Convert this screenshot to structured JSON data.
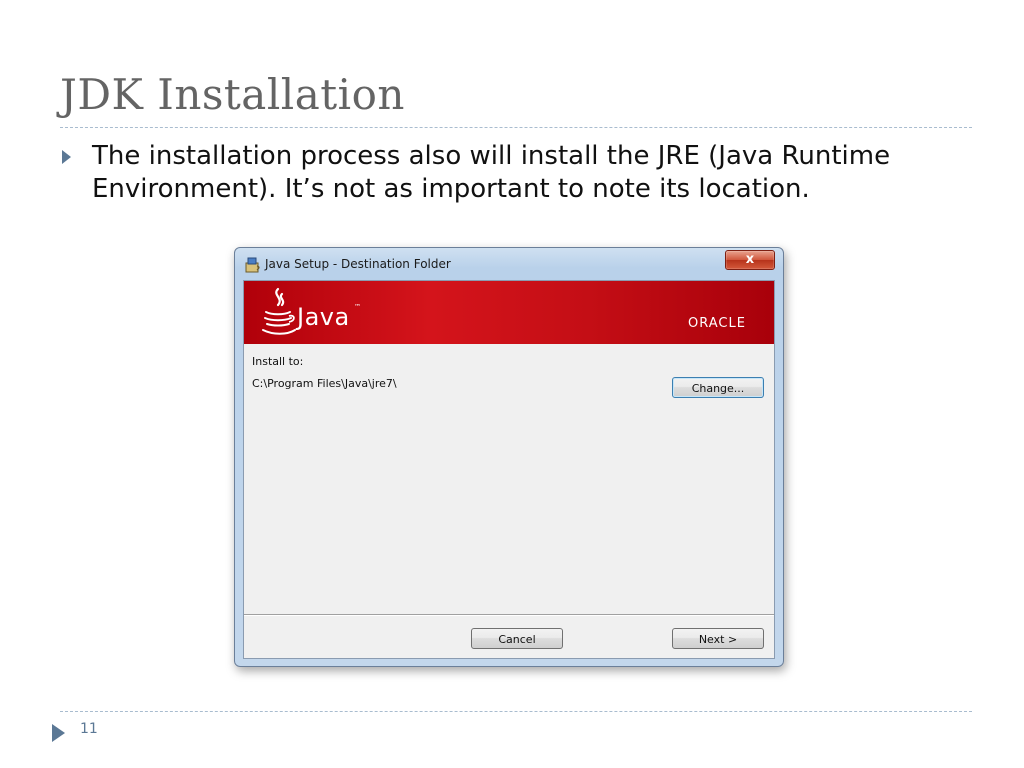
{
  "slide": {
    "title": "JDK Installation",
    "bullet_text": "The installation process also will install the JRE (Java Runtime Environment). It’s not as important to note its location.",
    "slide_number": "11"
  },
  "dialog": {
    "title": "Java Setup - Destination Folder",
    "close_glyph": "x",
    "banner": {
      "java_wordmark": "Java",
      "java_tm": "™",
      "oracle_wordmark": "ORACLE"
    },
    "install_label": "Install to:",
    "install_path": "C:\\Program Files\\Java\\jre7\\",
    "change_button": "Change...",
    "cancel_button": "Cancel",
    "next_button": "Next >"
  },
  "colors": {
    "banner_red": "#c40e15",
    "title_gray": "#646464",
    "accent_blue": "#5b7895"
  },
  "icons": {
    "title_icon": "java-setup-icon",
    "logo": "java-cup-logo",
    "bullet": "bullet-arrow-icon",
    "footer": "footer-arrow-icon"
  }
}
